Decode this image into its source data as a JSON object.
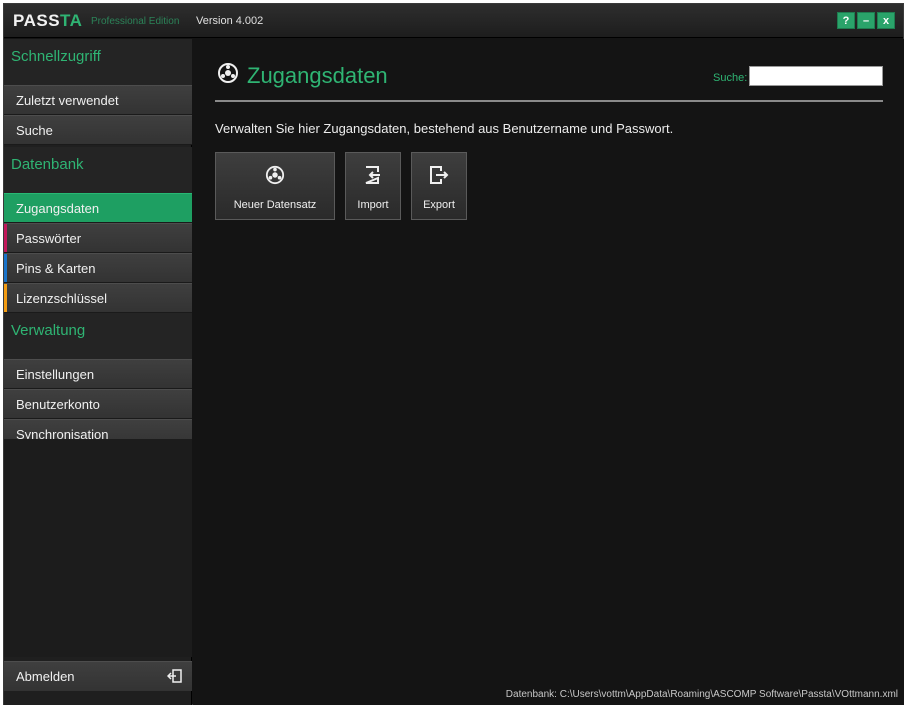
{
  "titlebar": {
    "brand_pass": "PASS",
    "brand_ta": "TA",
    "edition": "Professional Edition",
    "version": "Version 4.002",
    "help": "?",
    "minimize": "–",
    "close": "x"
  },
  "sidebar": {
    "quick_heading": "Schnellzugriff",
    "quick_items": [
      {
        "label": "Zuletzt verwendet"
      },
      {
        "label": "Suche"
      }
    ],
    "db_heading": "Datenbank",
    "db_items": [
      {
        "label": "Zugangsdaten",
        "accent": "#1e9f62",
        "active": true
      },
      {
        "label": "Passwörter",
        "accent": "#c2185b"
      },
      {
        "label": "Pins & Karten",
        "accent": "#1a73c9"
      },
      {
        "label": "Lizenzschlüssel",
        "accent": "#f39c12"
      }
    ],
    "admin_heading": "Verwaltung",
    "admin_items": [
      {
        "label": "Einstellungen"
      },
      {
        "label": "Benutzerkonto"
      },
      {
        "label": "Synchronisation"
      }
    ],
    "logout_label": "Abmelden",
    "logout_icon": "logout-icon"
  },
  "main": {
    "title": "Zugangsdaten",
    "title_icon": "credentials-icon",
    "search_label": "Suche:",
    "search_value": "",
    "description": "Verwalten Sie hier Zugangsdaten, bestehend aus Benutzername und Passwort.",
    "actions": [
      {
        "label": "Neuer Datensatz",
        "icon": "new-record-icon"
      },
      {
        "label": "Import",
        "icon": "import-icon"
      },
      {
        "label": "Export",
        "icon": "export-icon"
      }
    ],
    "status": "Datenbank: C:\\Users\\vottm\\AppData\\Roaming\\ASCOMP Software\\Passta\\VOttmann.xml"
  },
  "colors": {
    "accent": "#2fb473",
    "active": "#1e9f62",
    "background": "#141414",
    "sidebar": "#1f1f1f"
  }
}
